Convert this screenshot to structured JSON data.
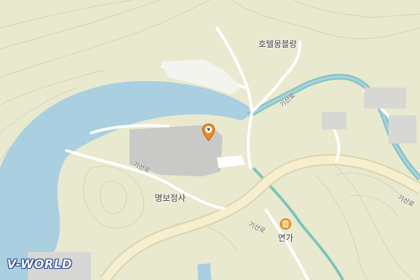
{
  "map": {
    "colors": {
      "land": "#e8e9cf",
      "water": "#a9cfe0",
      "road": "#ffffff",
      "major_road": "#f6efcf",
      "contour": "#d5d3b6",
      "building": "#c9cac7",
      "stream": "#7cc4ba"
    },
    "labels": {
      "hotel": "호텔몽블랑",
      "temple": "명보정사",
      "restaurant": "연가"
    },
    "road_labels": {
      "r1": "기산로",
      "r2": "기산로",
      "r3": "기산로",
      "r4": "기산로"
    },
    "marker": {
      "icon": "location-pin-icon"
    },
    "poi": {
      "icon": "restaurant-icon"
    },
    "logo": "V-WORLD"
  }
}
